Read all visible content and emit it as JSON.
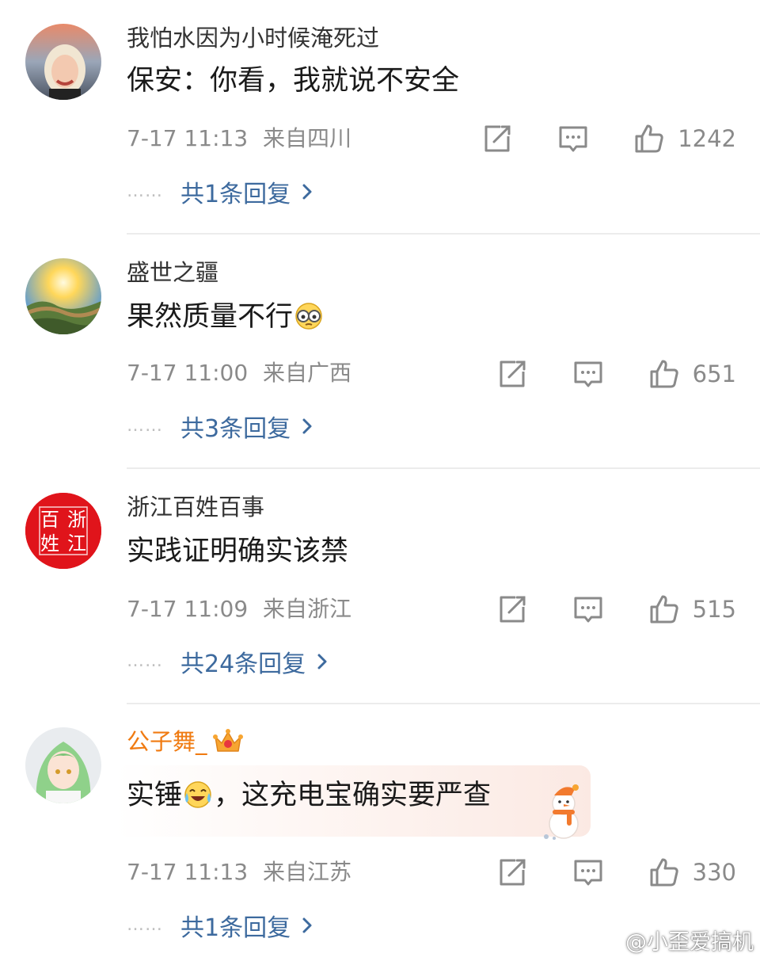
{
  "comments": [
    {
      "username": "我怕水因为小时候淹死过",
      "text": "保安：你看，我就说不安全",
      "date": "7-17 11:13",
      "location": "来自四川",
      "likes": "1242",
      "replies_label": "共1条回复"
    },
    {
      "username": "盛世之疆",
      "text": "果然质量不行",
      "date": "7-17 11:00",
      "location": "来自广西",
      "likes": "651",
      "replies_label": "共3条回复"
    },
    {
      "username": "浙江百姓百事",
      "avatar_text": [
        "百",
        "浙",
        "姓",
        "江"
      ],
      "text": "实践证明确实该禁",
      "date": "7-17 11:09",
      "location": "来自浙江",
      "likes": "515",
      "replies_label": "共24条回复"
    },
    {
      "username": "公子舞_",
      "text_part1": "实锤",
      "text_part2": "，这充电宝确实要严查",
      "date": "7-17 11:13",
      "location": "来自江苏",
      "likes": "330",
      "replies_label": "共1条回复"
    }
  ],
  "dots": "……",
  "watermark": "@小歪爱搞机",
  "icons": {
    "share": "share-icon",
    "comment": "comment-icon",
    "like": "thumbs-up-icon",
    "arrow": "chevron-right-icon"
  },
  "colors": {
    "link": "#3d6a9e",
    "vip_name": "#f07b12",
    "meta": "#8a8a8a"
  }
}
